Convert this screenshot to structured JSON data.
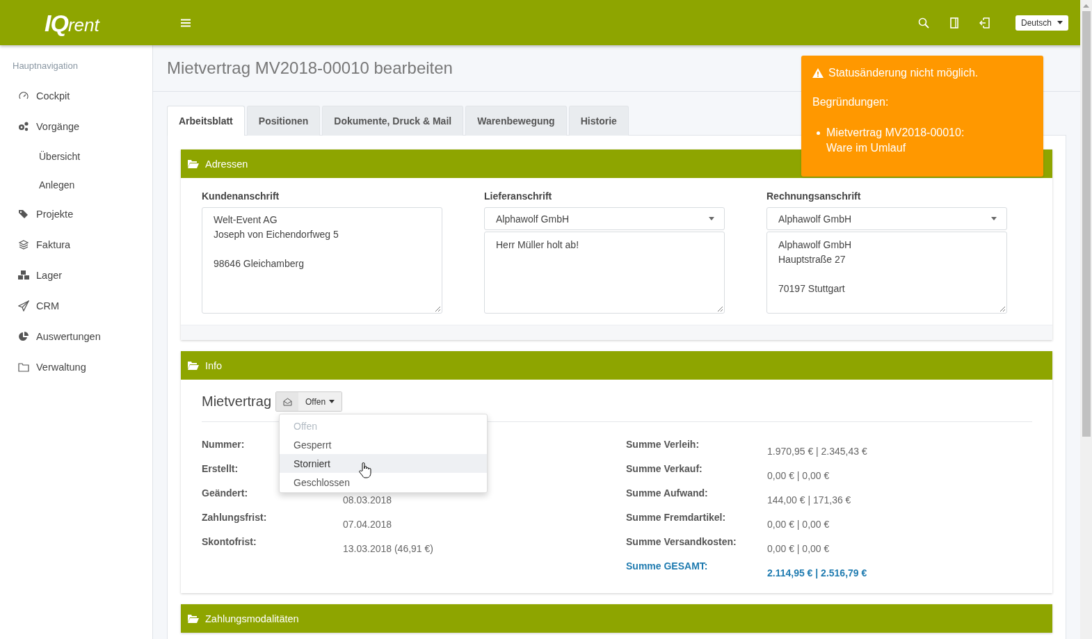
{
  "header": {
    "logo": {
      "strong": "IQ",
      "light": "rent"
    },
    "language": "Deutsch"
  },
  "sidebar": {
    "heading": "Hauptnavigation",
    "items": [
      {
        "label": "Cockpit"
      },
      {
        "label": "Vorgänge",
        "children": [
          {
            "label": "Übersicht"
          },
          {
            "label": "Anlegen"
          }
        ]
      },
      {
        "label": "Projekte"
      },
      {
        "label": "Faktura"
      },
      {
        "label": "Lager"
      },
      {
        "label": "CRM"
      },
      {
        "label": "Auswertungen"
      },
      {
        "label": "Verwaltung"
      }
    ]
  },
  "page_title": "Mietvertrag MV2018-00010 bearbeiten",
  "tabs": [
    {
      "label": "Arbeitsblatt",
      "selected": true
    },
    {
      "label": "Positionen",
      "selected": false
    },
    {
      "label": "Dokumente, Druck & Mail",
      "selected": false
    },
    {
      "label": "Warenbewegung",
      "selected": false
    },
    {
      "label": "Historie",
      "selected": false
    }
  ],
  "addresses": {
    "title": "Adressen",
    "columns": [
      {
        "kind": "textarea",
        "label": "Kundenanschrift",
        "text": "Welt-Event AG\nJoseph von Eichendorfweg 5\n\n98646 Gleichamberg"
      },
      {
        "kind": "select",
        "label": "Lieferanschrift",
        "select": "Alphawolf GmbH",
        "text": "Herr Müller holt ab!"
      },
      {
        "kind": "select",
        "label": "Rechnungsanschrift",
        "select": "Alphawolf GmbH",
        "text": "Alphawolf GmbH\nHauptstraße 27\n\n70197 Stuttgart"
      }
    ]
  },
  "info": {
    "title": "Info",
    "heading": "Mietvertrag",
    "status": "Offen",
    "status_menu": [
      {
        "label": "Offen",
        "disabled": true,
        "highlighted": false
      },
      {
        "label": "Gesperrt",
        "disabled": false,
        "highlighted": false
      },
      {
        "label": "Storniert",
        "disabled": false,
        "highlighted": true
      },
      {
        "label": "Geschlossen",
        "disabled": false,
        "highlighted": false
      }
    ],
    "left": [
      {
        "label": "Nummer:"
      },
      {
        "label": "Erstellt:"
      },
      {
        "label": "Geändert:",
        "value": "08.03.2018"
      },
      {
        "label": "Zahlungsfrist:",
        "value": "07.04.2018"
      },
      {
        "label": "Skontofrist:",
        "value": "13.03.2018 (46,91 €)"
      }
    ],
    "right": [
      {
        "kind": "sum",
        "label": "Summe Verleih:",
        "value": "1.970,95 € | 2.345,43 €"
      },
      {
        "kind": "sum",
        "label": "Summe Verkauf:",
        "value": "0,00 € | 0,00 €"
      },
      {
        "kind": "sum",
        "label": "Summe Aufwand:",
        "value": "144,00 € | 171,36 €"
      },
      {
        "kind": "sum",
        "label": "Summe Fremdartikel:",
        "value": "0,00 € | 0,00 €"
      },
      {
        "kind": "sum",
        "label": "Summe Versandkosten:",
        "value": "0,00 € | 0,00 €"
      },
      {
        "kind": "total",
        "label": "Summe GESAMT:",
        "value": "2.114,95 € | 2.516,79 €"
      }
    ]
  },
  "payment": {
    "title": "Zahlungsmodalitäten"
  },
  "alert": {
    "title": "Statusänderung nicht möglich.",
    "subtitle": "Begründungen:",
    "reasons": [
      {
        "lines": [
          "Mietvertrag MV2018-00010:",
          "Ware im Umlauf"
        ]
      }
    ]
  }
}
